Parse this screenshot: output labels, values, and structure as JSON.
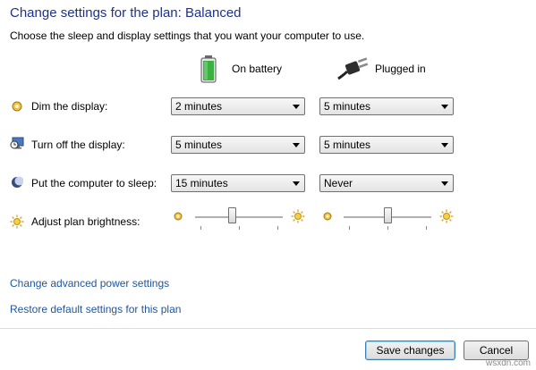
{
  "header": {
    "title": "Change settings for the plan: Balanced",
    "subtitle": "Choose the sleep and display settings that you want your computer to use."
  },
  "columns": {
    "battery": "On battery",
    "plugged": "Plugged in"
  },
  "rows": {
    "dim": {
      "label": "Dim the display:",
      "battery": "2 minutes",
      "plugged": "5 minutes"
    },
    "off": {
      "label": "Turn off the display:",
      "battery": "5 minutes",
      "plugged": "5 minutes"
    },
    "sleep": {
      "label": "Put the computer to sleep:",
      "battery": "15 minutes",
      "plugged": "Never"
    },
    "brightness": {
      "label": "Adjust plan brightness:",
      "battery_level": 0.42,
      "plugged_level": 0.5
    }
  },
  "links": {
    "advanced": "Change advanced power settings",
    "restore": "Restore default settings for this plan"
  },
  "buttons": {
    "save": "Save changes",
    "cancel": "Cancel"
  },
  "watermark": "wsxdn.com",
  "colors": {
    "title": "#1e3287",
    "link": "#1e56a0",
    "battery_green": "#3cb043"
  }
}
